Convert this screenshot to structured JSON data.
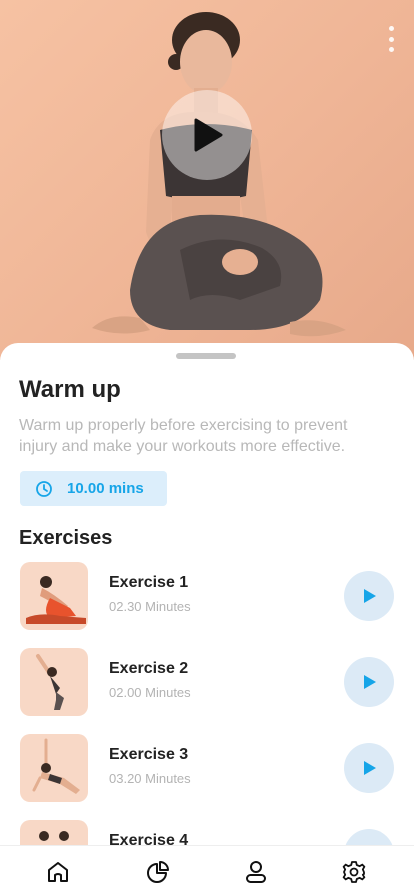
{
  "workout": {
    "title": "Warm up",
    "description": "Warm up properly before exercising to prevent injury and make your workouts more effective.",
    "duration": "10.00 mins"
  },
  "section_title": "Exercises",
  "exercises": [
    {
      "name": "Exercise 1",
      "duration": "02.30 Minutes"
    },
    {
      "name": "Exercise 2",
      "duration": "02.00 Minutes"
    },
    {
      "name": "Exercise 3",
      "duration": "03.20 Minutes"
    },
    {
      "name": "Exercise 4",
      "duration": ""
    }
  ],
  "nav": [
    "home-icon",
    "chart-icon",
    "profile-icon",
    "settings-icon"
  ],
  "colors": {
    "accent": "#16a5e8",
    "hero_bg": "#f6c2a3",
    "chip_bg": "#dceefb",
    "thumb_bg": "#f8d8c6"
  }
}
